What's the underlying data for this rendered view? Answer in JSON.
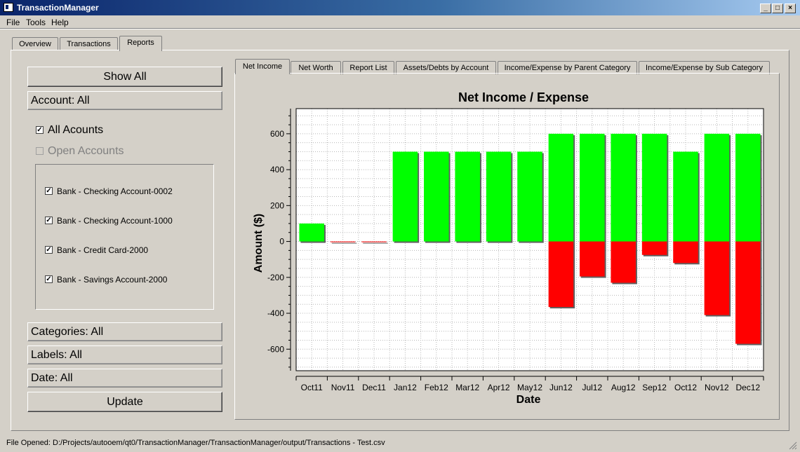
{
  "window": {
    "title": "TransactionManager"
  },
  "menu": [
    "File",
    "Tools",
    "Help"
  ],
  "main_tabs": [
    {
      "label": "Overview",
      "active": false
    },
    {
      "label": "Transactions",
      "active": false
    },
    {
      "label": "Reports",
      "active": true
    }
  ],
  "sidebar": {
    "show_all": "Show All",
    "account_filter": "Account: All",
    "all_accounts": {
      "label": "All Acounts",
      "checked": true
    },
    "open_accounts": {
      "label": "Open Accounts",
      "checked": false,
      "disabled": true
    },
    "accounts": [
      {
        "label": "Bank - Checking Account-0002",
        "checked": true
      },
      {
        "label": "Bank - Checking Account-1000",
        "checked": true
      },
      {
        "label": "Bank - Credit Card-2000",
        "checked": true
      },
      {
        "label": "Bank - Savings Account-2000",
        "checked": true
      }
    ],
    "categories_filter": "Categories: All",
    "labels_filter": "Labels: All",
    "date_filter": "Date: All",
    "update": "Update"
  },
  "report_tabs": [
    {
      "label": "Net Income",
      "active": true
    },
    {
      "label": "Net Worth",
      "active": false
    },
    {
      "label": "Report List",
      "active": false
    },
    {
      "label": "Assets/Debts by Account",
      "active": false
    },
    {
      "label": "Income/Expense by Parent Category",
      "active": false
    },
    {
      "label": "Income/Expense by Sub Category",
      "active": false
    }
  ],
  "chart_data": {
    "type": "bar",
    "title": "Net Income / Expense",
    "xlabel": "Date",
    "ylabel": "Amount ($)",
    "categories": [
      "Oct11",
      "Nov11",
      "Dec11",
      "Jan12",
      "Feb12",
      "Mar12",
      "Apr12",
      "May12",
      "Jun12",
      "Jul12",
      "Aug12",
      "Sep12",
      "Oct12",
      "Nov12",
      "Dec12"
    ],
    "series": [
      {
        "values": [
          100,
          0,
          0,
          500,
          500,
          500,
          500,
          500,
          600,
          600,
          600,
          600,
          500,
          600,
          600
        ],
        "color": "#00ff00"
      },
      {
        "values": [
          0,
          -2,
          -2,
          0,
          0,
          0,
          0,
          0,
          -365,
          -195,
          -230,
          -75,
          -120,
          -410,
          -570
        ],
        "color": "#ff0000"
      }
    ],
    "ylim": [
      -720,
      740
    ],
    "yticks": [
      -600,
      -400,
      -200,
      0,
      200,
      400,
      600
    ],
    "grid": true
  },
  "statusbar": {
    "text": "File Opened: D:/Projects/autooem/qt0/TransactionManager/TransactionManager/output/Transactions - Test.csv"
  }
}
